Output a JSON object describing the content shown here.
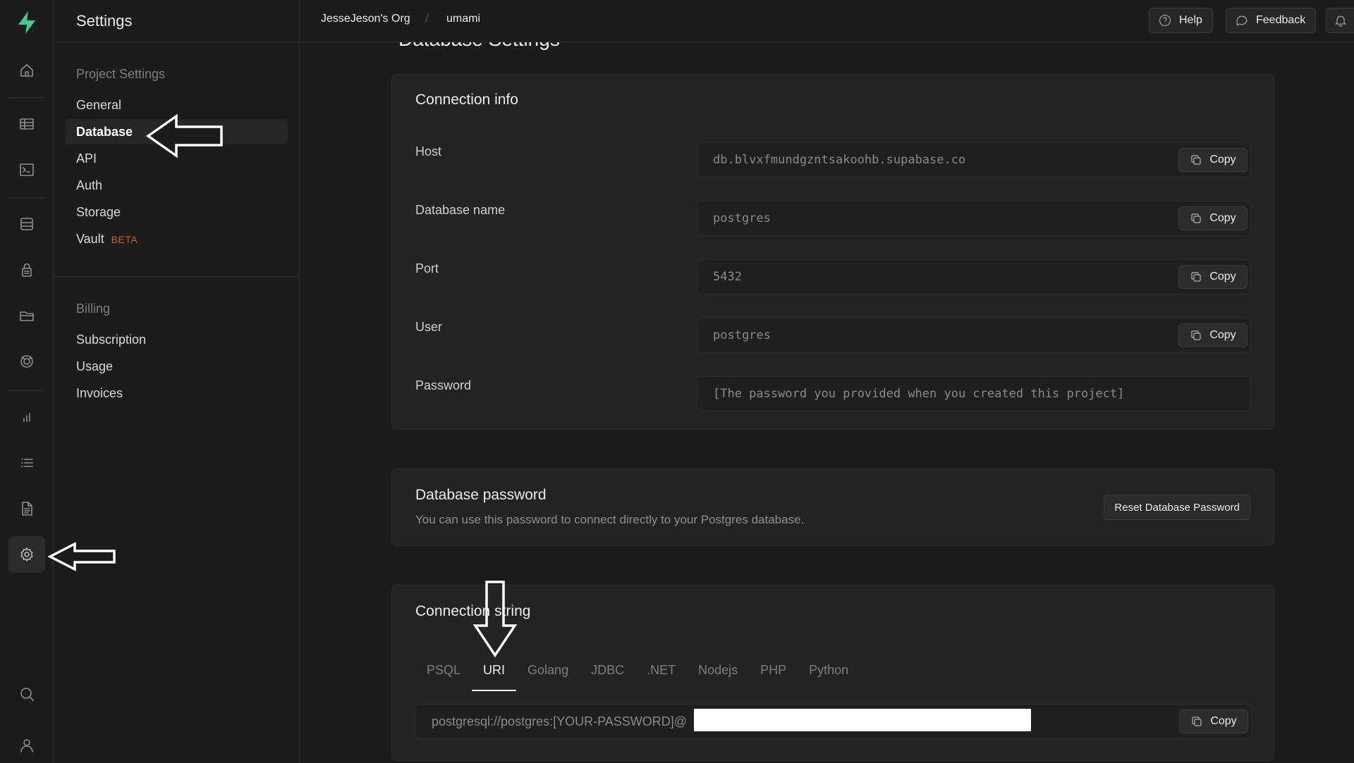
{
  "sidebar_menu": {
    "title": "Settings",
    "groups": [
      {
        "title": "Project Settings",
        "items": [
          {
            "label": "General"
          },
          {
            "label": "Database"
          },
          {
            "label": "API"
          },
          {
            "label": "Auth"
          },
          {
            "label": "Storage"
          },
          {
            "label": "Vault",
            "badge": "BETA"
          }
        ]
      },
      {
        "title": "Billing",
        "items": [
          {
            "label": "Subscription"
          },
          {
            "label": "Usage"
          },
          {
            "label": "Invoices"
          }
        ]
      }
    ],
    "active_item": "Database"
  },
  "rail": {
    "icons": [
      "logo-icon",
      "home-icon",
      "table-editor-icon",
      "sql-editor-icon",
      "database-icon",
      "auth-lock-icon",
      "storage-icon",
      "edge-functions-icon",
      "reports-icon",
      "logs-icon",
      "api-docs-icon",
      "settings-icon",
      "search-icon",
      "user-icon"
    ],
    "active": "settings-icon"
  },
  "topbar": {
    "org": "JesseJeson's Org",
    "separator": "/",
    "project": "umami",
    "help_label": "Help",
    "feedback_label": "Feedback"
  },
  "page": {
    "title": "Database Settings"
  },
  "connection_info": {
    "title": "Connection info",
    "fields": [
      {
        "label": "Host",
        "value": "db.blvxfmundgzntsakoohb.supabase.co",
        "copy": "Copy"
      },
      {
        "label": "Database name",
        "value": "postgres",
        "copy": "Copy"
      },
      {
        "label": "Port",
        "value": "5432",
        "copy": "Copy"
      },
      {
        "label": "User",
        "value": "postgres",
        "copy": "Copy"
      },
      {
        "label": "Password",
        "value": "[The password you provided when you created this project]"
      }
    ]
  },
  "database_password": {
    "title": "Database password",
    "description": "You can use this password to connect directly to your Postgres database.",
    "reset_label": "Reset Database Password"
  },
  "connection_string": {
    "title": "Connection string",
    "tabs": [
      "PSQL",
      "URI",
      "Golang",
      "JDBC",
      ".NET",
      "Nodejs",
      "PHP",
      "Python"
    ],
    "active_tab": "URI",
    "uri_value": "postgresql://postgres:[YOUR-PASSWORD]@",
    "copy": "Copy"
  },
  "colors": {
    "background": "#1c1c1c",
    "brand": "#3ecf8e",
    "beta": "#c2691e"
  }
}
